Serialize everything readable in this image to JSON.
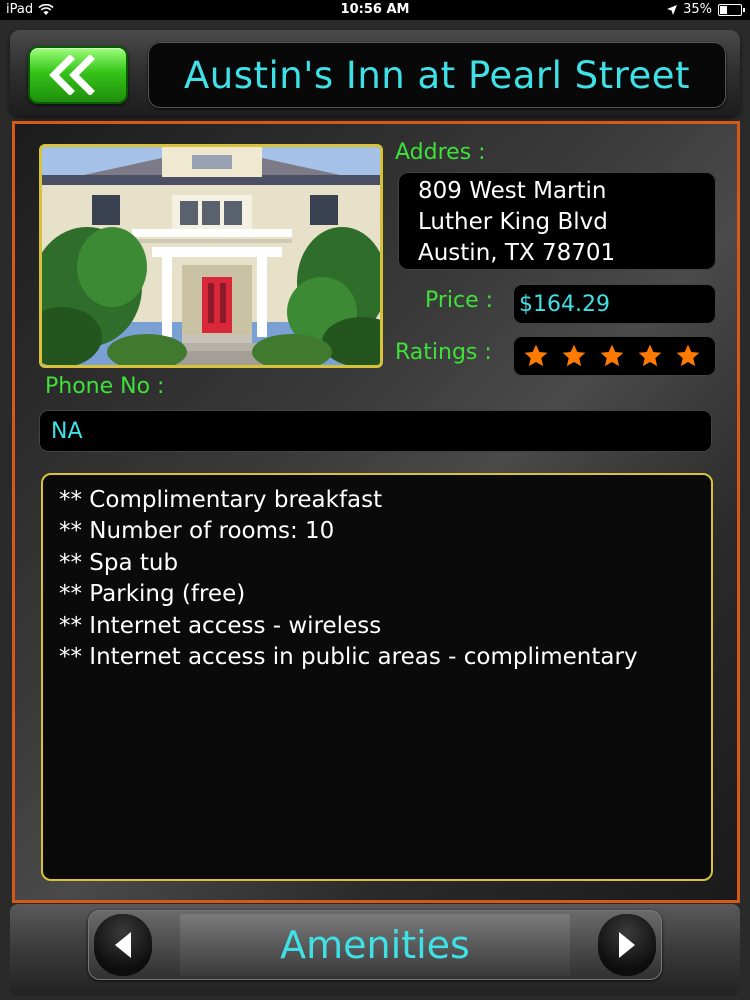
{
  "status_bar": {
    "device": "iPad",
    "time": "10:56 AM",
    "battery": "35%",
    "battery_level": 0.35
  },
  "header": {
    "back_icon": "double-chevron-left-icon",
    "title": "Austin's Inn at Pearl Street"
  },
  "details": {
    "address_label": "Addres :",
    "address_lines": [
      "809 West Martin",
      "Luther King Blvd",
      "Austin, TX 78701"
    ],
    "price_label": "Price :",
    "price": "$164.29",
    "ratings_label": "Ratings :",
    "rating": 5,
    "phone_label": "Phone No :",
    "phone": "NA"
  },
  "amenities": [
    "** Complimentary breakfast",
    "** Number of rooms: 10",
    "** Spa tub",
    "** Parking (free)",
    "** Internet access - wireless",
    "** Internet access in public areas - complimentary"
  ],
  "footer": {
    "prev_icon": "triangle-left-icon",
    "section_title": "Amenities",
    "next_icon": "triangle-right-icon"
  },
  "colors": {
    "accent_cyan": "#3fe0e6",
    "label_green": "#3ee03a",
    "star_orange": "#ff7a00",
    "panel_border": "#d35a18",
    "gold_border": "#d8c23a"
  }
}
